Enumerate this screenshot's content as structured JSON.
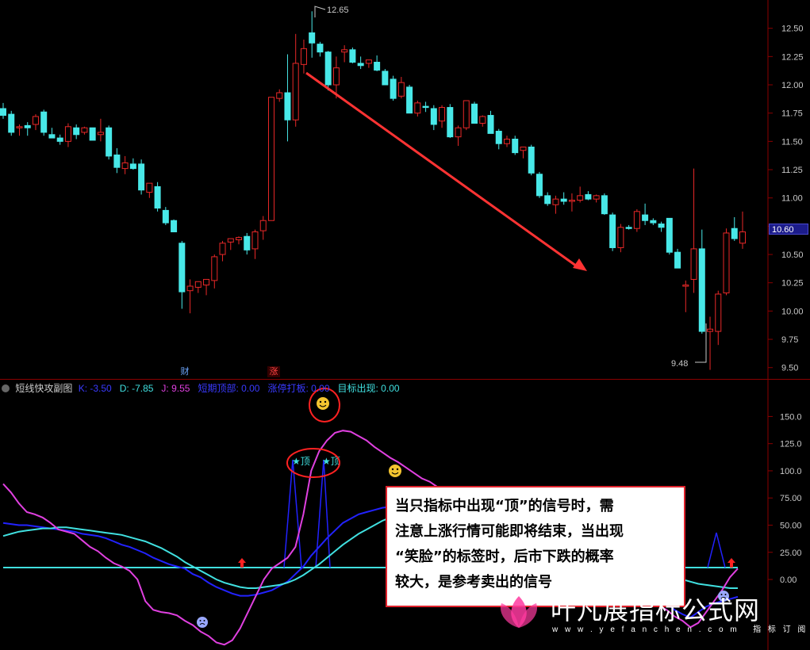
{
  "chart_data": [
    {
      "type": "candlestick",
      "y_ticks": [
        "12.50",
        "12.25",
        "12.00",
        "11.75",
        "11.50",
        "11.25",
        "11.00",
        "10.75",
        "10.50",
        "10.25",
        "10.00",
        "9.75",
        "9.50"
      ],
      "ylim": [
        9.4,
        12.75
      ],
      "last_price_label": "10.60",
      "high_label": "12.65",
      "low_label": "9.48",
      "event_tags": [
        "财",
        "涨"
      ],
      "candles": [
        {
          "o": 11.79,
          "h": 11.84,
          "l": 11.7,
          "c": 11.73
        },
        {
          "o": 11.74,
          "h": 11.77,
          "l": 11.55,
          "c": 11.58
        },
        {
          "o": 11.62,
          "h": 11.65,
          "l": 11.55,
          "c": 11.63
        },
        {
          "o": 11.64,
          "h": 11.67,
          "l": 11.55,
          "c": 11.62
        },
        {
          "o": 11.65,
          "h": 11.74,
          "l": 11.6,
          "c": 11.72
        },
        {
          "o": 11.76,
          "h": 11.78,
          "l": 11.55,
          "c": 11.58
        },
        {
          "o": 11.56,
          "h": 11.62,
          "l": 11.53,
          "c": 11.53
        },
        {
          "o": 11.53,
          "h": 11.56,
          "l": 11.47,
          "c": 11.5
        },
        {
          "o": 11.5,
          "h": 11.66,
          "l": 11.45,
          "c": 11.63
        },
        {
          "o": 11.62,
          "h": 11.65,
          "l": 11.52,
          "c": 11.56
        },
        {
          "o": 11.58,
          "h": 11.63,
          "l": 11.56,
          "c": 11.62
        },
        {
          "o": 11.62,
          "h": 11.62,
          "l": 11.51,
          "c": 11.51
        },
        {
          "o": 11.56,
          "h": 11.7,
          "l": 11.5,
          "c": 11.58
        },
        {
          "o": 11.62,
          "h": 11.64,
          "l": 11.34,
          "c": 11.37
        },
        {
          "o": 11.38,
          "h": 11.44,
          "l": 11.22,
          "c": 11.27
        },
        {
          "o": 11.26,
          "h": 11.37,
          "l": 11.21,
          "c": 11.31
        },
        {
          "o": 11.3,
          "h": 11.35,
          "l": 11.25,
          "c": 11.26
        },
        {
          "o": 11.3,
          "h": 11.34,
          "l": 11.03,
          "c": 11.07
        },
        {
          "o": 11.05,
          "h": 11.13,
          "l": 11.0,
          "c": 11.13
        },
        {
          "o": 11.1,
          "h": 11.14,
          "l": 10.88,
          "c": 10.91
        },
        {
          "o": 10.89,
          "h": 10.92,
          "l": 10.76,
          "c": 10.78
        },
        {
          "o": 10.8,
          "h": 10.81,
          "l": 10.7,
          "c": 10.7
        },
        {
          "o": 10.6,
          "h": 10.62,
          "l": 10.02,
          "c": 10.17
        },
        {
          "o": 10.18,
          "h": 10.28,
          "l": 9.98,
          "c": 10.22
        },
        {
          "o": 10.21,
          "h": 10.26,
          "l": 10.16,
          "c": 10.26
        },
        {
          "o": 10.23,
          "h": 10.28,
          "l": 10.14,
          "c": 10.28
        },
        {
          "o": 10.27,
          "h": 10.5,
          "l": 10.2,
          "c": 10.48
        },
        {
          "o": 10.5,
          "h": 10.62,
          "l": 10.44,
          "c": 10.6
        },
        {
          "o": 10.61,
          "h": 10.64,
          "l": 10.54,
          "c": 10.64
        },
        {
          "o": 10.63,
          "h": 10.66,
          "l": 10.59,
          "c": 10.65
        },
        {
          "o": 10.66,
          "h": 10.69,
          "l": 10.5,
          "c": 10.54
        },
        {
          "o": 10.55,
          "h": 10.72,
          "l": 10.46,
          "c": 10.7
        },
        {
          "o": 10.71,
          "h": 10.84,
          "l": 10.63,
          "c": 10.8
        },
        {
          "o": 10.8,
          "h": 11.89,
          "l": 10.8,
          "c": 11.89
        },
        {
          "o": 11.88,
          "h": 11.96,
          "l": 11.85,
          "c": 11.93
        },
        {
          "o": 11.93,
          "h": 12.27,
          "l": 11.5,
          "c": 11.69
        },
        {
          "o": 11.69,
          "h": 12.45,
          "l": 11.63,
          "c": 12.19
        },
        {
          "o": 12.18,
          "h": 12.4,
          "l": 12.1,
          "c": 12.32
        },
        {
          "o": 12.46,
          "h": 12.65,
          "l": 12.24,
          "c": 12.37
        },
        {
          "o": 12.36,
          "h": 12.38,
          "l": 12.25,
          "c": 12.29
        },
        {
          "o": 12.29,
          "h": 12.3,
          "l": 11.95,
          "c": 12.0
        },
        {
          "o": 12.0,
          "h": 12.25,
          "l": 11.88,
          "c": 12.15
        },
        {
          "o": 12.29,
          "h": 12.35,
          "l": 12.2,
          "c": 12.31
        },
        {
          "o": 12.31,
          "h": 12.33,
          "l": 12.19,
          "c": 12.2
        },
        {
          "o": 12.19,
          "h": 12.25,
          "l": 12.14,
          "c": 12.17
        },
        {
          "o": 12.19,
          "h": 12.22,
          "l": 12.15,
          "c": 12.22
        },
        {
          "o": 12.2,
          "h": 12.26,
          "l": 12.12,
          "c": 12.13
        },
        {
          "o": 12.12,
          "h": 12.14,
          "l": 12.0,
          "c": 12.0
        },
        {
          "o": 12.05,
          "h": 12.08,
          "l": 11.86,
          "c": 11.88
        },
        {
          "o": 11.9,
          "h": 12.07,
          "l": 11.88,
          "c": 12.02
        },
        {
          "o": 11.98,
          "h": 12.0,
          "l": 11.75,
          "c": 11.75
        },
        {
          "o": 11.75,
          "h": 11.86,
          "l": 11.72,
          "c": 11.84
        },
        {
          "o": 11.81,
          "h": 11.85,
          "l": 11.76,
          "c": 11.8
        },
        {
          "o": 11.79,
          "h": 11.82,
          "l": 11.6,
          "c": 11.65
        },
        {
          "o": 11.68,
          "h": 11.82,
          "l": 11.62,
          "c": 11.8
        },
        {
          "o": 11.8,
          "h": 11.83,
          "l": 11.53,
          "c": 11.54
        },
        {
          "o": 11.54,
          "h": 11.64,
          "l": 11.46,
          "c": 11.62
        },
        {
          "o": 11.62,
          "h": 11.86,
          "l": 11.6,
          "c": 11.86
        },
        {
          "o": 11.83,
          "h": 11.85,
          "l": 11.66,
          "c": 11.66
        },
        {
          "o": 11.66,
          "h": 11.73,
          "l": 11.63,
          "c": 11.72
        },
        {
          "o": 11.73,
          "h": 11.77,
          "l": 11.57,
          "c": 11.57
        },
        {
          "o": 11.59,
          "h": 11.61,
          "l": 11.43,
          "c": 11.48
        },
        {
          "o": 11.48,
          "h": 11.55,
          "l": 11.45,
          "c": 11.52
        },
        {
          "o": 11.52,
          "h": 11.55,
          "l": 11.38,
          "c": 11.4
        },
        {
          "o": 11.42,
          "h": 11.45,
          "l": 11.35,
          "c": 11.45
        },
        {
          "o": 11.45,
          "h": 11.47,
          "l": 11.2,
          "c": 11.22
        },
        {
          "o": 11.21,
          "h": 11.23,
          "l": 11.0,
          "c": 11.02
        },
        {
          "o": 11.02,
          "h": 11.05,
          "l": 10.93,
          "c": 10.95
        },
        {
          "o": 10.94,
          "h": 11.02,
          "l": 10.86,
          "c": 10.99
        },
        {
          "o": 10.99,
          "h": 11.05,
          "l": 10.94,
          "c": 10.97
        },
        {
          "o": 10.98,
          "h": 11.04,
          "l": 10.88,
          "c": 10.98
        },
        {
          "o": 10.98,
          "h": 11.1,
          "l": 10.96,
          "c": 11.02
        },
        {
          "o": 11.03,
          "h": 11.06,
          "l": 10.98,
          "c": 10.99
        },
        {
          "o": 10.99,
          "h": 11.03,
          "l": 10.96,
          "c": 11.02
        },
        {
          "o": 11.02,
          "h": 11.04,
          "l": 10.85,
          "c": 10.86
        },
        {
          "o": 10.85,
          "h": 10.87,
          "l": 10.53,
          "c": 10.56
        },
        {
          "o": 10.56,
          "h": 10.77,
          "l": 10.52,
          "c": 10.74
        },
        {
          "o": 10.74,
          "h": 10.76,
          "l": 10.72,
          "c": 10.73
        },
        {
          "o": 10.73,
          "h": 10.9,
          "l": 10.7,
          "c": 10.88
        },
        {
          "o": 10.85,
          "h": 10.95,
          "l": 10.76,
          "c": 10.8
        },
        {
          "o": 10.8,
          "h": 10.82,
          "l": 10.76,
          "c": 10.78
        },
        {
          "o": 10.77,
          "h": 10.79,
          "l": 10.7,
          "c": 10.74
        },
        {
          "o": 10.82,
          "h": 10.82,
          "l": 10.5,
          "c": 10.52
        },
        {
          "o": 10.52,
          "h": 10.55,
          "l": 10.38,
          "c": 10.38
        },
        {
          "o": 10.23,
          "h": 10.27,
          "l": 9.99,
          "c": 10.23
        },
        {
          "o": 10.28,
          "h": 11.26,
          "l": 10.16,
          "c": 10.55
        },
        {
          "o": 10.55,
          "h": 10.72,
          "l": 9.8,
          "c": 9.82
        },
        {
          "o": 9.82,
          "h": 9.95,
          "l": 9.48,
          "c": 9.84
        },
        {
          "o": 9.82,
          "h": 10.18,
          "l": 9.7,
          "c": 10.15
        },
        {
          "o": 10.16,
          "h": 10.73,
          "l": 10.14,
          "c": 10.69
        },
        {
          "o": 10.73,
          "h": 10.83,
          "l": 10.62,
          "c": 10.64
        },
        {
          "o": 10.6,
          "h": 10.88,
          "l": 10.55,
          "c": 10.7
        }
      ],
      "trend_arrow": "down"
    },
    {
      "type": "line",
      "name": "短线快攻副图",
      "legend": [
        {
          "label": "K: -3.50",
          "color": "#3a3aff"
        },
        {
          "label": "D: -7.85",
          "color": "#40e0e0"
        },
        {
          "label": "J: 9.55",
          "color": "#e040e0"
        },
        {
          "label": "短期顶部: 0.00",
          "color": "#3a3aff"
        },
        {
          "label": "涨停打板: 0.00",
          "color": "#3a3aff"
        },
        {
          "label": "目标出现: 0.00",
          "color": "#40e0e0"
        }
      ],
      "y_ticks": [
        "150.0",
        "125.0",
        "100.0",
        "75.00",
        "50.00",
        "25.00",
        "0.00"
      ],
      "ylim": [
        -62,
        170
      ],
      "x_count": 94,
      "series": [
        {
          "name": "K",
          "color": "#2222ff",
          "values": [
            52,
            51,
            50,
            50,
            49,
            48,
            47,
            46,
            45,
            44,
            42,
            41,
            40,
            38,
            35,
            32,
            30,
            27,
            24,
            20,
            17,
            14,
            12,
            10,
            5,
            2,
            -3,
            -7,
            -10,
            -13,
            -15,
            -15,
            -14,
            -12,
            -10,
            -6,
            -2,
            5,
            12,
            22,
            30,
            38,
            45,
            52,
            56,
            60,
            62,
            64,
            66,
            67,
            68,
            69,
            70,
            70,
            71,
            71,
            70,
            70,
            69,
            68,
            66,
            64,
            61,
            58,
            55,
            52,
            48,
            44,
            40,
            36,
            32,
            28,
            24,
            20,
            16,
            12,
            8,
            4,
            0,
            -3,
            -6,
            -10,
            -14,
            -18,
            -22,
            -28,
            -32,
            -35,
            -30,
            -25,
            -22,
            -20,
            -18,
            -16
          ]
        },
        {
          "name": "D",
          "color": "#40e0e0",
          "values": [
            40,
            42,
            44,
            45,
            46,
            47,
            47,
            48,
            48,
            47,
            46,
            45,
            44,
            43,
            42,
            41,
            39,
            37,
            35,
            32,
            29,
            25,
            21,
            16,
            12,
            8,
            4,
            0,
            -3,
            -5,
            -7,
            -8,
            -8,
            -7,
            -6,
            -5,
            -3,
            0,
            4,
            9,
            14,
            20,
            26,
            32,
            37,
            42,
            46,
            50,
            54,
            57,
            60,
            62,
            64,
            65,
            66,
            67,
            68,
            68,
            68,
            68,
            67,
            66,
            65,
            63,
            61,
            59,
            57,
            54,
            51,
            48,
            45,
            42,
            39,
            36,
            33,
            30,
            27,
            24,
            21,
            18,
            15,
            12,
            9,
            6,
            4,
            2,
            0,
            -2,
            -4,
            -5,
            -6,
            -7,
            -8,
            -8
          ]
        },
        {
          "name": "J",
          "color": "#e040e0",
          "values": [
            88,
            80,
            70,
            62,
            60,
            57,
            52,
            46,
            44,
            42,
            36,
            30,
            26,
            20,
            15,
            12,
            8,
            0,
            -20,
            -28,
            -30,
            -31,
            -33,
            -38,
            -42,
            -48,
            -52,
            -58,
            -60,
            -56,
            -45,
            -30,
            -15,
            0,
            10,
            15,
            20,
            30,
            60,
            100,
            118,
            128,
            135,
            137,
            136,
            132,
            128,
            122,
            117,
            112,
            108,
            103,
            98,
            93,
            90,
            85,
            80,
            76,
            72,
            66,
            60,
            56,
            53,
            50,
            48,
            45,
            42,
            40,
            38,
            36,
            33,
            30,
            26,
            22,
            18,
            14,
            10,
            6,
            2,
            -3,
            -7,
            -12,
            -18,
            -24,
            -28,
            -34,
            -38,
            -44,
            -40,
            -30,
            -20,
            -10,
            2,
            10
          ]
        }
      ],
      "signal_labels": [
        "★顶",
        "★顶"
      ]
    }
  ],
  "callout": {
    "lines": [
      "当只指标中出现“顶”的信号时，需",
      "注意上涨行情可能即将结束，当出现",
      "“笑脸”的标签时，后市下跌的概率",
      "较大，是参考卖出的信号"
    ]
  },
  "watermark": {
    "brand": "叶凡展指标公式网",
    "url": "w w w . y e f a n c h e n . c o m",
    "suffix": "指 标 订 阅"
  },
  "colors": {
    "up": "#e82828",
    "down": "#48e8e8",
    "grid": "#8b0000",
    "axis_text": "#c8c8c8",
    "arrow": "#ff3333"
  }
}
